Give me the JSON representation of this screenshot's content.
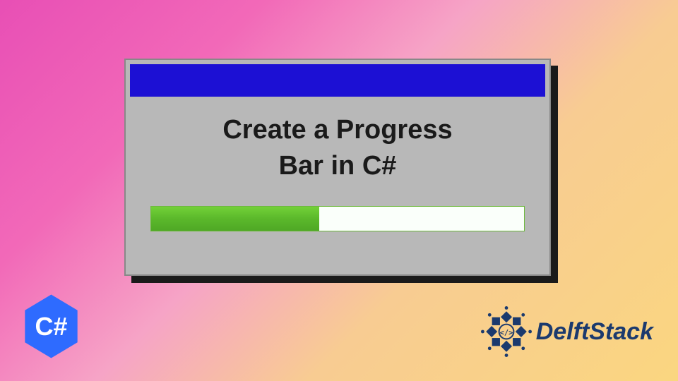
{
  "dialog": {
    "title_line1": "Create a Progress",
    "title_line2": "Bar in C#",
    "progress_percent": 45
  },
  "badges": {
    "csharp_label": "C#",
    "csharp_color": "#2e6bff",
    "delftstack_label": "DelftStack",
    "delftstack_color": "#1b3a6e"
  },
  "colors": {
    "titlebar": "#1c10d4",
    "dialog_bg": "#b8b8b8",
    "progress_fill": "#5bb82b",
    "progress_bg": "#fafffa"
  }
}
